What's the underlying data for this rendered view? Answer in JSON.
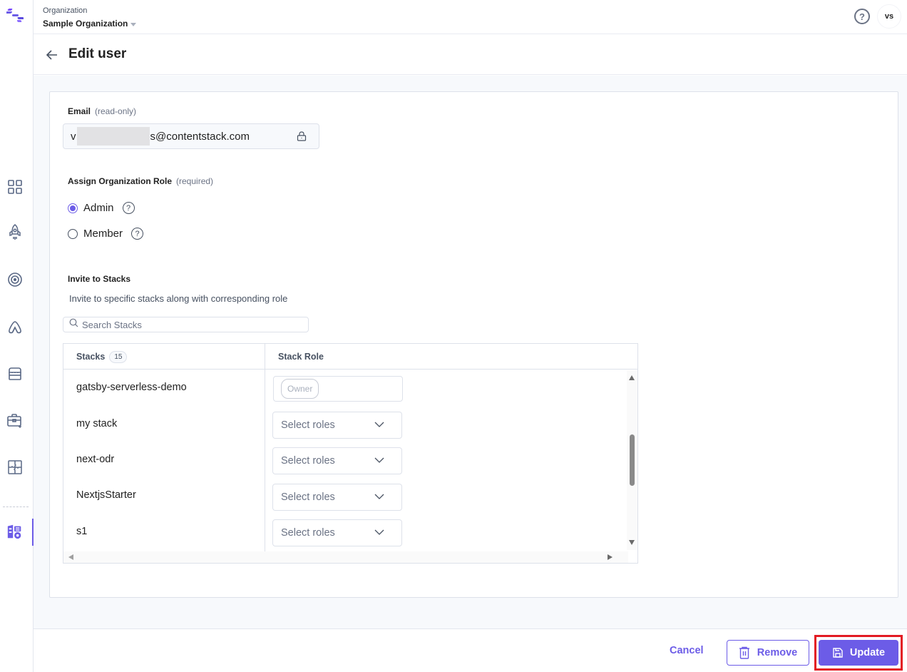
{
  "header": {
    "org_label": "Organization",
    "org_name": "Sample Organization",
    "help_icon": "question-circle-icon",
    "avatar_initials": "vs"
  },
  "sidebar": {
    "logo_icon": "contentstack-logo-icon",
    "items": [
      {
        "icon": "dashboard-grid-icon",
        "active": false
      },
      {
        "icon": "rocket-launch-icon",
        "active": false
      },
      {
        "icon": "target-icon",
        "active": false
      },
      {
        "icon": "automate-icon",
        "active": false
      },
      {
        "icon": "marketplace-store-icon",
        "active": false
      },
      {
        "icon": "toolbox-icon",
        "active": false
      },
      {
        "icon": "puzzle-extensions-icon",
        "active": false
      },
      {
        "icon": "organization-settings-icon",
        "active": true
      }
    ],
    "accent_color": "#6c5ce7"
  },
  "page": {
    "title": "Edit user",
    "back_icon": "arrow-left-icon"
  },
  "form": {
    "email": {
      "label": "Email",
      "hint": "(read-only)",
      "value_prefix": "v",
      "value_suffix": "s@contentstack.com",
      "lock_icon": "lock-icon"
    },
    "org_role": {
      "label": "Assign Organization Role",
      "hint": "(required)",
      "options": [
        {
          "label": "Admin",
          "selected": true
        },
        {
          "label": "Member",
          "selected": false
        }
      ]
    },
    "stacks": {
      "label": "Invite to Stacks",
      "description": "Invite to specific stacks along with corresponding role",
      "search_placeholder": "Search Stacks",
      "search_value": "",
      "columns": {
        "stacks": "Stacks",
        "stack_role": "Stack Role"
      },
      "count": "15",
      "rows": [
        {
          "name": "gatsby-serverless-demo",
          "role": "Owner",
          "locked": true
        },
        {
          "name": "my stack",
          "role": "Select roles",
          "locked": false
        },
        {
          "name": "next-odr",
          "role": "Select roles",
          "locked": false
        },
        {
          "name": "NextjsStarter",
          "role": "Select roles",
          "locked": false
        },
        {
          "name": "s1",
          "role": "Select roles",
          "locked": false
        }
      ]
    }
  },
  "footer": {
    "cancel_label": "Cancel",
    "remove_label": "Remove",
    "update_label": "Update",
    "highlight_color": "#e31b23"
  }
}
